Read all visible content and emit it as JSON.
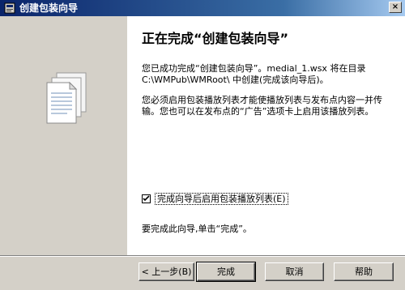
{
  "window": {
    "title": "创建包装向导",
    "close_glyph": "×"
  },
  "main": {
    "heading": "正在完成“创建包装向导”",
    "para1": "您已成功完成“创建包装向导”。medial_1.wsx 将在目录 C:\\WMPub\\WMRoot\\ 中创建(完成该向导后)。",
    "para2": "您必须启用包装播放列表才能使播放列表与发布点内容一并传输。您也可以在发布点的“广告”选项卡上启用该播放列表。",
    "checkbox_label": "完成向导后启用包装播放列表(E)",
    "checkbox_checked": true,
    "para3": "要完成此向导,单击“完成”。"
  },
  "buttons": {
    "back": "< 上一步(B)",
    "finish": "完成",
    "cancel": "取消",
    "help": "帮助"
  },
  "icons": {
    "title_icon": "wizard-icon",
    "doc_icon": "documents-icon"
  }
}
